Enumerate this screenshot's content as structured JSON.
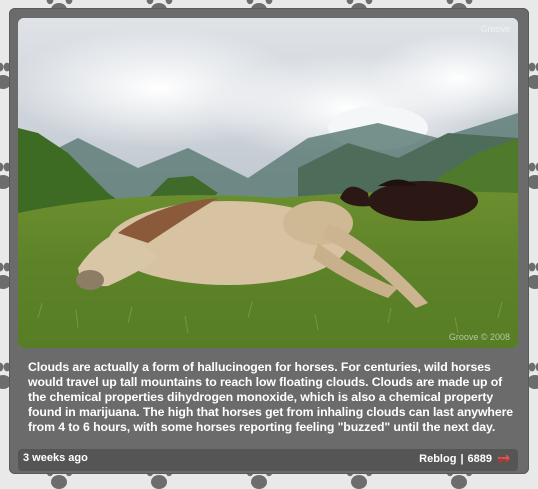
{
  "post": {
    "image_alt": "Horses lying in a grassy mountain meadow under clouds",
    "watermark_top": "Groove",
    "watermark_bottom": "Groove © 2008",
    "caption": "Clouds are actually a form of hallucinogen for horses. For centuries, wild horses would travel up tall mountains to reach low floating clouds. Clouds are made up of the chemical properties dihydrogen monoxide, which is also a chemical property found in marijuana. The high that horses get from inhaling clouds can last anywhere from 4 to 6 hours, with some horses reporting feeling \"buzzed\" until the next day."
  },
  "footer": {
    "timestamp": "3 weeks ago",
    "reblog_label": "Reblog",
    "separator": "|",
    "note_count": "6889"
  },
  "icons": {
    "background": "paw-print-icon",
    "reblog": "reblog-icon"
  },
  "colors": {
    "card": "#6b6b6b",
    "footer": "#555555",
    "reblog_icon": "#d9534f"
  }
}
